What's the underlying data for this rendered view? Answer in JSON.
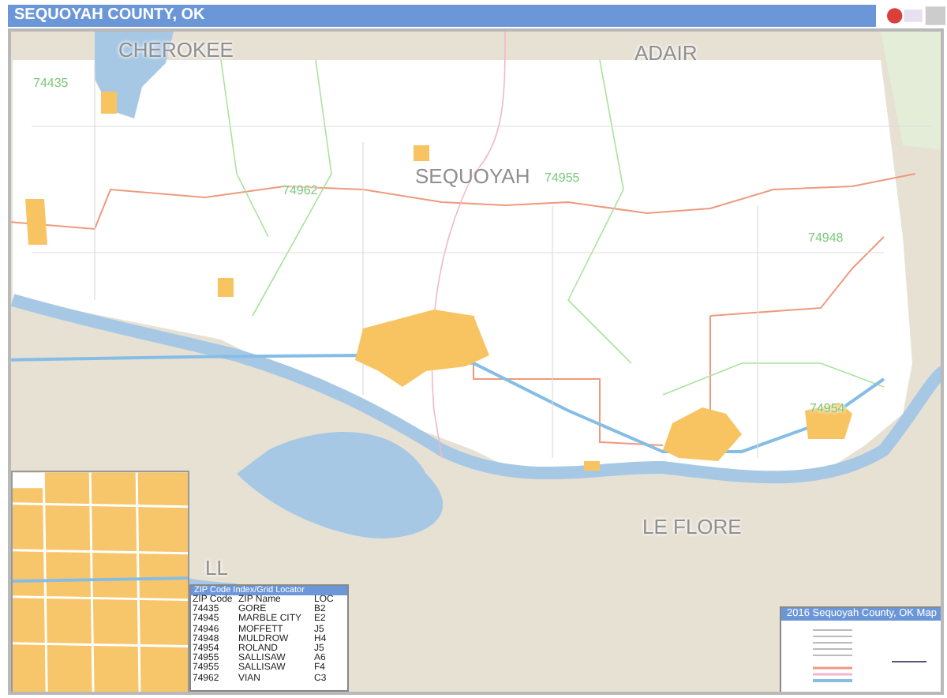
{
  "title": "SEQUOYAH COUNTY, OK",
  "map_labels": [
    {
      "kind": "county",
      "text": "CHEROKEE"
    },
    {
      "kind": "county",
      "text": "ADAIR"
    },
    {
      "kind": "county",
      "text": "SEQUOYAH"
    },
    {
      "kind": "county",
      "text": "LE FLORE"
    },
    {
      "kind": "county",
      "text": "LL"
    },
    {
      "kind": "zip",
      "text": "74435"
    },
    {
      "kind": "zip",
      "text": "74962"
    },
    {
      "kind": "zip",
      "text": "74955"
    },
    {
      "kind": "zip",
      "text": "74948"
    },
    {
      "kind": "zip",
      "text": "74954"
    }
  ],
  "zip_index": {
    "title": "ZIP Code Index/Grid Locator",
    "columns": [
      "ZIP Code",
      "ZIP Name",
      "LOC"
    ],
    "rows": [
      [
        "74435",
        "GORE",
        "B2"
      ],
      [
        "74945",
        "MARBLE CITY",
        "E2"
      ],
      [
        "74946",
        "MOFFETT",
        "J5"
      ],
      [
        "74948",
        "MULDROW",
        "H4"
      ],
      [
        "74954",
        "ROLAND",
        "J5"
      ],
      [
        "74955",
        "SALLISAW",
        "A6"
      ],
      [
        "74955",
        "SALLISAW",
        "F4"
      ],
      [
        "74962",
        "VIAN",
        "C3"
      ]
    ]
  },
  "legend": {
    "title": "2016 Sequoyah County, OK Map"
  }
}
